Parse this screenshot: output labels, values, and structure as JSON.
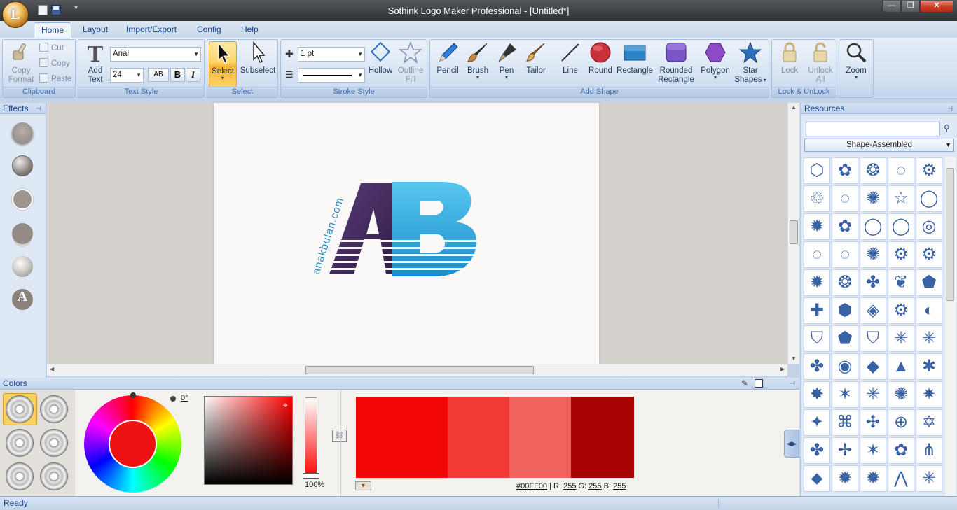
{
  "app": {
    "title": "Sothink Logo Maker Professional - [Untitled*]",
    "orb_letter": "L"
  },
  "window_controls": {
    "minimize": "—",
    "maximize": "❐",
    "close": "✕"
  },
  "tabs": [
    "Home",
    "Layout",
    "Import/Export",
    "Config",
    "Help"
  ],
  "ribbon": {
    "clipboard": {
      "label": "Clipboard",
      "copy_format": [
        "Copy",
        "Format"
      ],
      "cut": "Cut",
      "copy": "Copy",
      "paste": "Paste"
    },
    "text_style": {
      "label": "Text Style",
      "add_text": [
        "Add",
        "Text"
      ],
      "font": "Arial",
      "size": "24",
      "bold": "B",
      "italic": "I",
      "ab": "AB"
    },
    "select": {
      "label": "Select",
      "select": "Select",
      "subselect": "Subselect"
    },
    "stroke_style": {
      "label": "Stroke Style",
      "width": "1 pt",
      "hollow": "Hollow",
      "outline_fill": [
        "Outline",
        "Fill"
      ]
    },
    "add_shape": {
      "label": "Add Shape",
      "pencil": "Pencil",
      "brush": "Brush",
      "pen": "Pen",
      "tailor": "Tailor",
      "line": "Line",
      "round": "Round",
      "rectangle": "Rectangle",
      "rounded_rectangle": [
        "Rounded",
        "Rectangle"
      ],
      "polygon": "Polygon",
      "star_shapes": [
        "Star",
        "Shapes"
      ]
    },
    "lock": {
      "label": "Lock & UnLock",
      "lock": "Lock",
      "unlock_all": [
        "Unlock",
        "All"
      ]
    },
    "zoom": "Zoom"
  },
  "effects": {
    "title": "Effects",
    "letter_effect": "A"
  },
  "canvas": {
    "logo_letters": "AB",
    "logo_tagline": "anakbulan.com",
    "colors": {
      "purple": "#3b2453",
      "blue": "#29a9dc"
    }
  },
  "resources": {
    "title": "Resources",
    "search_value": "",
    "category": "Shape-Assembled",
    "shape_glyphs": [
      "⬡",
      "✿",
      "❂",
      "◌",
      "⚙",
      "♲",
      "◌",
      "✺",
      "☆",
      "◯",
      "✹",
      "✿",
      "◯",
      "◯",
      "◎",
      "◌",
      "◌",
      "✺",
      "⚙",
      "⚙",
      "✹",
      "❂",
      "✤",
      "❦",
      "⬟",
      "✚",
      "⬢",
      "◈",
      "⚙",
      "◐",
      "⛉",
      "⬟",
      "⛉",
      "✳",
      "✳",
      "✤",
      "◉",
      "◆",
      "▲",
      "✱",
      "✸",
      "✶",
      "✳",
      "✺",
      "✷",
      "✦",
      "⌘",
      "✣",
      "⊕",
      "✡",
      "✤",
      "✢",
      "✶",
      "✿",
      "⋔",
      "⬥",
      "✹",
      "✹",
      "⋀",
      "✳"
    ]
  },
  "colors": {
    "title": "Colors",
    "angle": "0°",
    "alpha_percent": "100",
    "percent_sign": "%",
    "hex": "#00FF00",
    "r_label": "R:",
    "r": "255",
    "g_label": "G:",
    "g": "255",
    "b_label": "B:",
    "b": "255",
    "palette": [
      "#f30606",
      "#f43a36",
      "#f1625f",
      "#a80202"
    ],
    "main_color": "#ee1212"
  },
  "status": "Ready"
}
